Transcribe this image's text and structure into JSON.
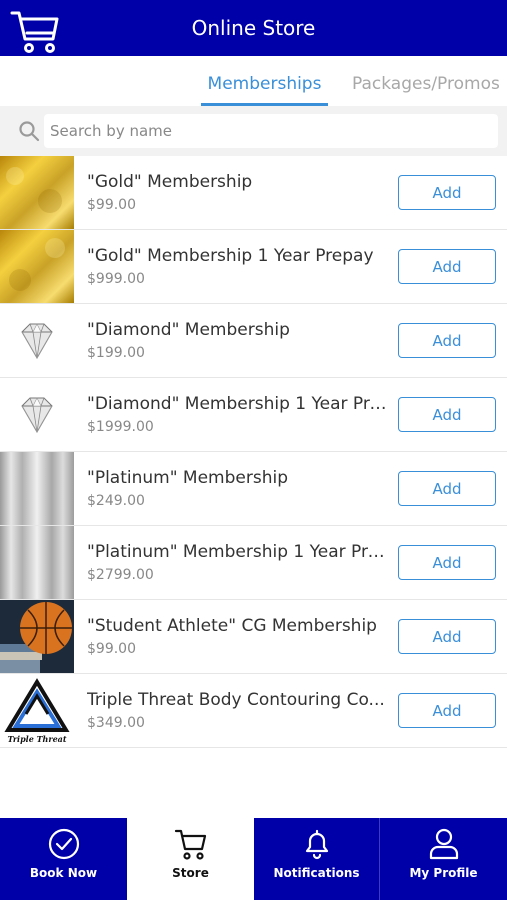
{
  "header": {
    "title": "Online Store",
    "icon": "cart-icon"
  },
  "tabs": [
    {
      "label": "Memberships",
      "active": true
    },
    {
      "label": "Packages/Promos",
      "active": false
    }
  ],
  "search": {
    "placeholder": "Search by name",
    "value": ""
  },
  "items": [
    {
      "name": "\"Gold\" Membership",
      "price": "$99.00",
      "button": "Add",
      "thumb": "gold-texture"
    },
    {
      "name": "\"Gold\" Membership 1 Year Prepay",
      "price": "$999.00",
      "button": "Add",
      "thumb": "gold-texture"
    },
    {
      "name": "\"Diamond\" Membership",
      "price": "$199.00",
      "button": "Add",
      "thumb": "diamond"
    },
    {
      "name": "\"Diamond\" Membership 1 Year Pre...",
      "price": "$1999.00",
      "button": "Add",
      "thumb": "diamond"
    },
    {
      "name": "\"Platinum\" Membership",
      "price": "$249.00",
      "button": "Add",
      "thumb": "brushed-metal"
    },
    {
      "name": "\"Platinum\" Membership 1 Year Pre...",
      "price": "$2799.00",
      "button": "Add",
      "thumb": "brushed-metal"
    },
    {
      "name": "\"Student Athlete\" CG Membership",
      "price": "$99.00",
      "button": "Add",
      "thumb": "basketball-books"
    },
    {
      "name": "Triple Threat Body Contouring Co...",
      "price": "$349.00",
      "button": "Add",
      "thumb": "triple-threat-logo",
      "logo_text": "Triple Threat"
    }
  ],
  "bottom_nav": [
    {
      "label": "Book Now",
      "icon": "check-circle-icon",
      "active": false
    },
    {
      "label": "Store",
      "icon": "cart-icon",
      "active": true
    },
    {
      "label": "Notifications",
      "icon": "bell-icon",
      "active": false
    },
    {
      "label": "My Profile",
      "icon": "user-icon",
      "active": false
    }
  ],
  "colors": {
    "brand": "#0000a8",
    "accent": "#3a8fd9",
    "background": "#ffffff"
  }
}
